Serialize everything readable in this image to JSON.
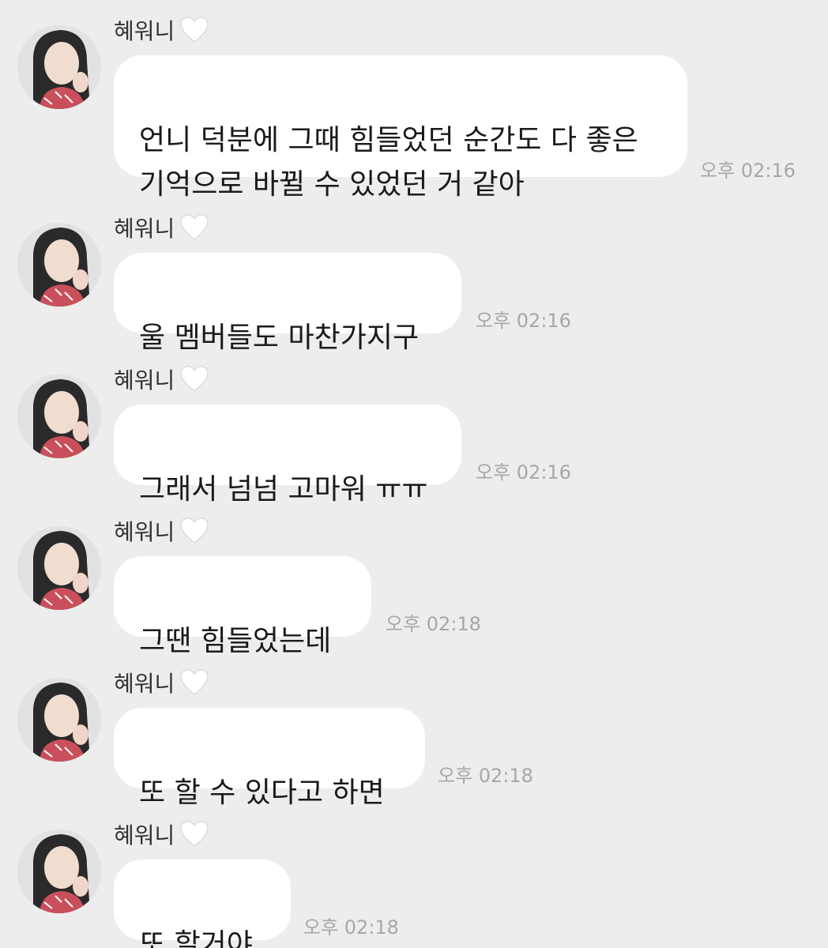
{
  "chat": {
    "messages": [
      {
        "sender": "혜워니",
        "text": "언니 덕분에 그때 힘들었던 순간도 다 좋은\n기억으로 바뀔 수 있었던 거 같아",
        "time": "오후 02:16"
      },
      {
        "sender": "혜워니",
        "text": "울 멤버들도 마찬가지구",
        "time": "오후 02:16"
      },
      {
        "sender": "혜워니",
        "text": "그래서 넘넘 고마워 ㅠㅠ",
        "time": "오후 02:16"
      },
      {
        "sender": "혜워니",
        "text": "그땐 힘들었는데",
        "time": "오후 02:18"
      },
      {
        "sender": "혜워니",
        "text": "또 할 수 있다고 하면",
        "time": "오후 02:18"
      },
      {
        "sender": "혜워니",
        "text": "또 할거야",
        "time": "오후 02:18"
      }
    ]
  },
  "colors": {
    "background": "#ededed",
    "bubble": "#ffffff",
    "timestamp": "#a7a7a7",
    "heart_outline": "#dcdcdc"
  },
  "icons": {
    "heart": "white-heart-icon"
  }
}
